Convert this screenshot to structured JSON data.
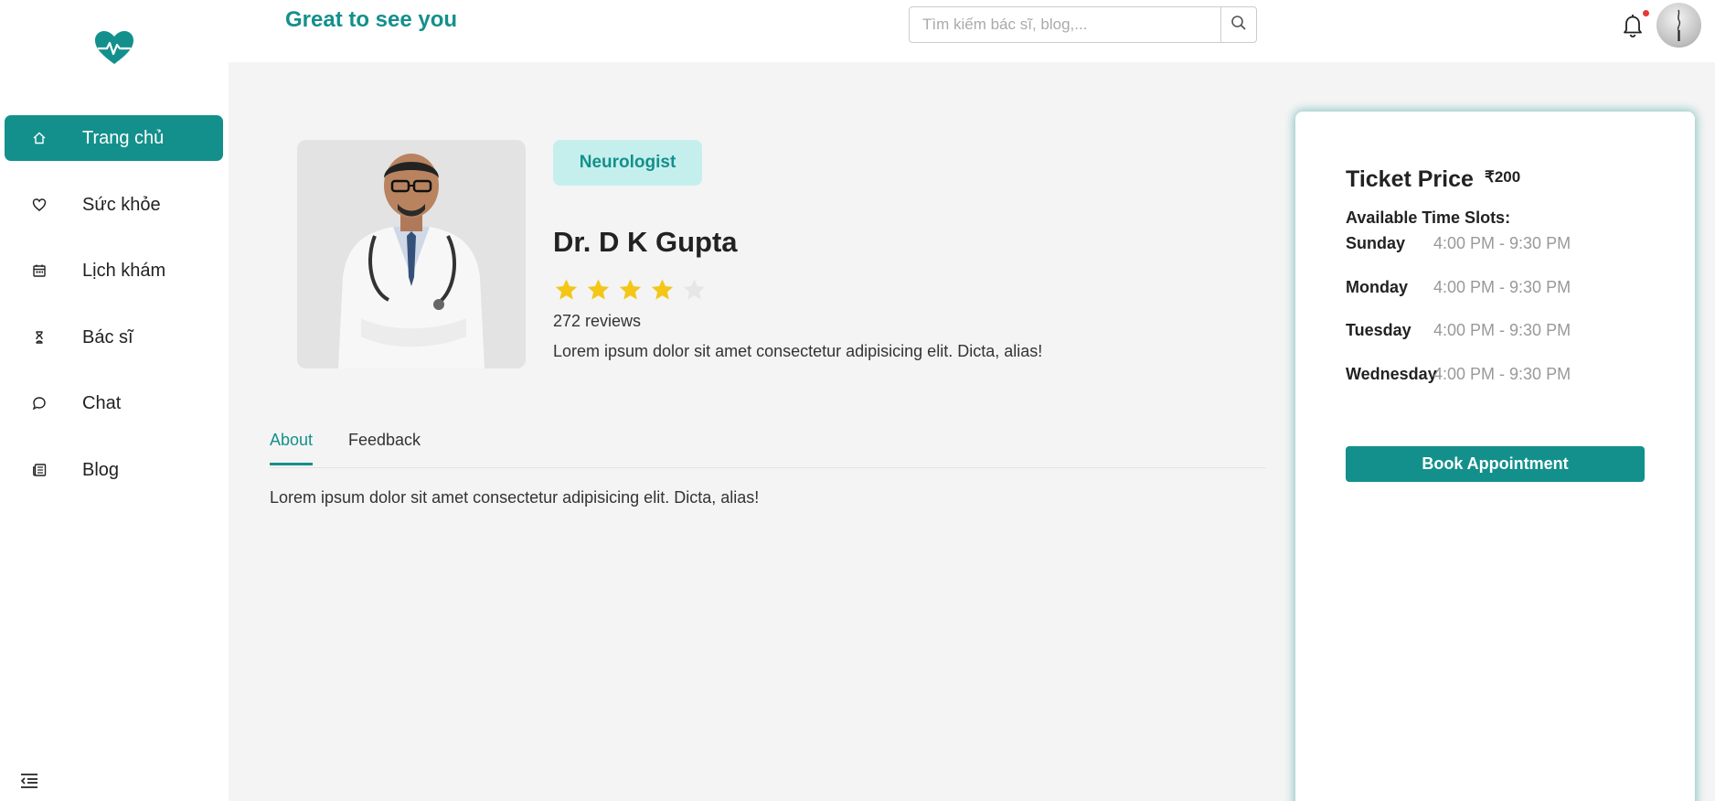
{
  "colors": {
    "accent": "#13908c",
    "accent_light": "#c5efed",
    "star": "#f5c518",
    "star_empty": "#e6e6e6",
    "notification": "#e53935"
  },
  "logo": {
    "icon": "heart-pulse-icon"
  },
  "sidebar": {
    "items": [
      {
        "label": "Trang chủ",
        "icon": "home-icon",
        "active": true
      },
      {
        "label": "Sức khỏe",
        "icon": "heart-icon",
        "active": false
      },
      {
        "label": "Lịch khám",
        "icon": "calendar-icon",
        "active": false
      },
      {
        "label": "Bác sĩ",
        "icon": "doctor-icon",
        "active": false
      },
      {
        "label": "Chat",
        "icon": "chat-icon",
        "active": false
      },
      {
        "label": "Blog",
        "icon": "newspaper-icon",
        "active": false
      }
    ],
    "collapse_icon": "collapse-menu-icon"
  },
  "header": {
    "greeting": "Great to see you",
    "search": {
      "placeholder": "Tìm kiếm bác sĩ, blog,...",
      "value": "",
      "icon": "search-icon"
    },
    "notification_icon": "bell-icon",
    "avatar_icon": "avatar"
  },
  "doctor": {
    "specialty": "Neurologist",
    "name": "Dr. D K Gupta",
    "rating": 4,
    "rating_max": 5,
    "reviews": "272 reviews",
    "description": "Lorem ipsum dolor sit amet consectetur adipisicing elit. Dicta, alias!"
  },
  "tabs": [
    {
      "label": "About",
      "active": true
    },
    {
      "label": "Feedback",
      "active": false
    }
  ],
  "about_text": "Lorem ipsum dolor sit amet consectetur adipisicing elit. Dicta, alias!",
  "booking": {
    "ticket_label": "Ticket Price",
    "ticket_price": "₹200",
    "slots_title": "Available Time Slots:",
    "slots": [
      {
        "day": "Sunday",
        "time": "4:00 PM - 9:30 PM"
      },
      {
        "day": "Monday",
        "time": "4:00 PM - 9:30 PM"
      },
      {
        "day": "Tuesday",
        "time": "4:00 PM - 9:30 PM"
      },
      {
        "day": "Wednesday",
        "time": "4:00 PM - 9:30 PM"
      }
    ],
    "button_label": "Book Appointment"
  }
}
